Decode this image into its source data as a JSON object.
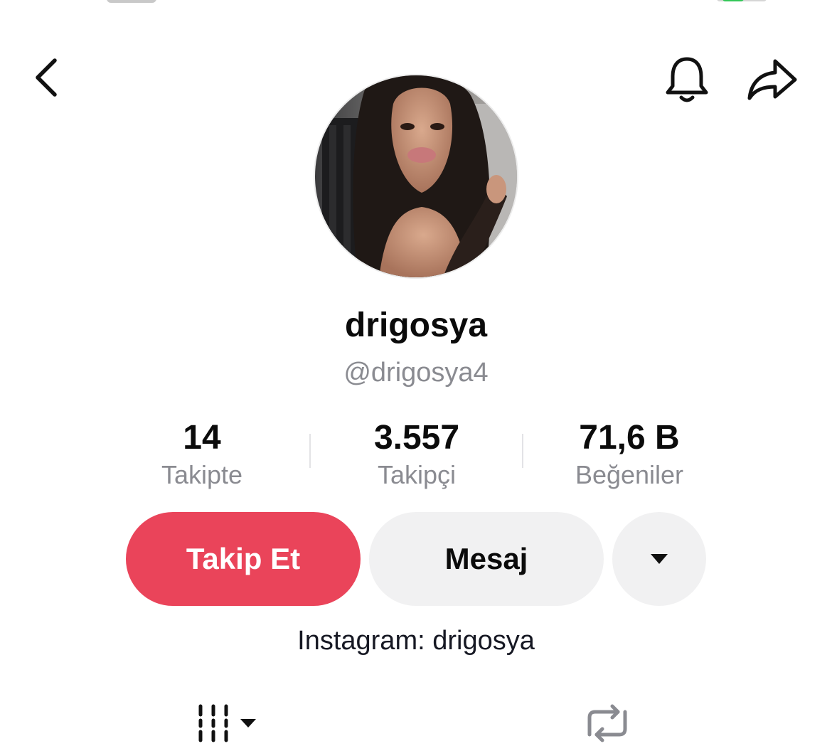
{
  "header": {
    "back_icon": "chevron-left-icon",
    "notification_icon": "bell-icon",
    "share_icon": "share-arrow-icon"
  },
  "profile": {
    "display_name": "drigosya",
    "handle": "@drigosya4",
    "bio": "Instagram: drigosya"
  },
  "stats": [
    {
      "value": "14",
      "label": "Takipte"
    },
    {
      "value": "3.557",
      "label": "Takipçi"
    },
    {
      "value": "71,6 B",
      "label": "Beğeniler"
    }
  ],
  "actions": {
    "follow_label": "Takip Et",
    "message_label": "Mesaj",
    "more_icon": "caret-down-icon"
  },
  "tabs": {
    "videos_icon": "videos-grid-icon",
    "reposts_icon": "repost-icon"
  },
  "colors": {
    "follow": "#ea445a",
    "secondary_button": "#f1f1f2",
    "muted_text": "#8a8b91"
  }
}
